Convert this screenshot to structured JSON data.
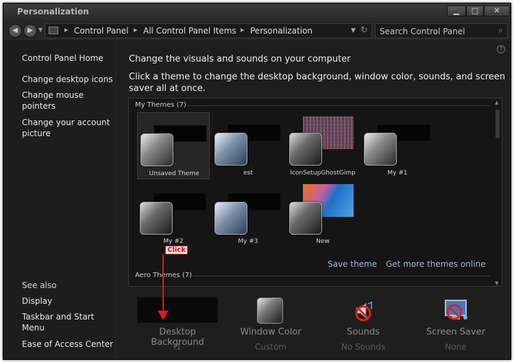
{
  "window": {
    "title": "Personalization"
  },
  "controls": {
    "minimize": "▁",
    "maximize": "□",
    "close": "✕"
  },
  "address": {
    "crumbs": [
      "Control Panel",
      "All Control Panel Items",
      "Personalization"
    ],
    "search_placeholder": "Search Control Panel"
  },
  "sidebar": {
    "home": "Control Panel Home",
    "links": [
      "Change desktop icons",
      "Change mouse pointers",
      "Change your account picture"
    ],
    "see_also": "See also",
    "see_also_links": [
      "Display",
      "Taskbar and Start Menu",
      "Ease of Access Center"
    ]
  },
  "main": {
    "heading": "Change the visuals and sounds on your computer",
    "subheading": "Click a theme to change the desktop background, window color, sounds, and screen saver all at once.",
    "groups": {
      "my_themes": "My Themes (7)",
      "aero_themes": "Aero Themes (7)"
    },
    "themes": [
      {
        "name": "Unsaved Theme",
        "selected": true,
        "tile": "gray"
      },
      {
        "name": "est",
        "selected": false,
        "tile": "blue"
      },
      {
        "name": "IconSetupGhostGimp",
        "selected": false,
        "tile": "dark"
      },
      {
        "name": "My #1",
        "selected": false,
        "tile": "gray"
      },
      {
        "name": "My #2",
        "selected": false,
        "tile": "dark"
      },
      {
        "name": "My #3",
        "selected": false,
        "tile": "blue"
      },
      {
        "name": "New",
        "selected": false,
        "tile": "dark"
      }
    ],
    "save_theme": "Save theme",
    "get_more": "Get more themes online"
  },
  "bottom": {
    "desktop_background": {
      "label": "Desktop Background",
      "value": "l1"
    },
    "window_color": {
      "label": "Window Color",
      "value": "Custom"
    },
    "sounds": {
      "label": "Sounds",
      "value": "No Sounds"
    },
    "screen_saver": {
      "label": "Screen Saver",
      "value": "None"
    }
  },
  "annotation": {
    "label": "Click",
    "color": "#e01818"
  }
}
